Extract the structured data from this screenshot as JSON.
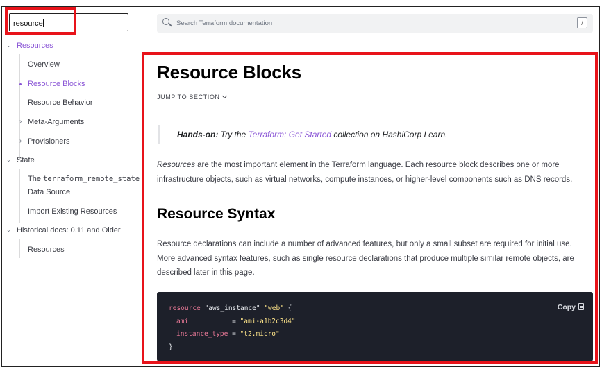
{
  "sidebar": {
    "filter_value": "resource",
    "items": [
      {
        "label": "Resources",
        "chevron": "⌄"
      },
      {
        "label": "Overview"
      },
      {
        "label": "Resource Blocks"
      },
      {
        "label": "Resource Behavior"
      },
      {
        "label": "Meta-Arguments",
        "chevron": "›"
      },
      {
        "label": "Provisioners",
        "chevron": "›"
      },
      {
        "label": "State",
        "chevron": "⌄"
      },
      {
        "label_line1_prefix": "The ",
        "label_line1_code": "terraform_remote_state",
        "label_line2": "Data Source"
      },
      {
        "label": "Import Existing Resources"
      },
      {
        "label": "Historical docs: 0.11 and Older",
        "chevron": "⌄"
      },
      {
        "label": "Resources"
      }
    ]
  },
  "search": {
    "placeholder": "Search Terraform documentation",
    "shortcut": "/"
  },
  "main": {
    "title": "Resource Blocks",
    "jump_label": "JUMP TO SECTION",
    "callout": {
      "bold": "Hands-on:",
      "before_link": " Try the ",
      "link": "Terraform: Get Started",
      "after_link": " collection on HashiCorp Learn."
    },
    "para1": {
      "italic": "Resources",
      "line1_rest": " are the most important element in the Terraform language. Each resource block describes one or more",
      "line2": "infrastructure objects, such as virtual networks, compute instances, or higher-level components such as DNS records."
    },
    "subtitle": "Resource Syntax",
    "para2": {
      "line1": "Resource declarations can include a number of advanced features, but only a small subset are required for initial use.",
      "line2": "More advanced syntax features, such as single resource declarations that produce multiple similar remote objects, are",
      "line3": "described later in this page."
    },
    "code": {
      "copy_label": "Copy",
      "l1_kw": "resource",
      "l1_s1": "\"aws_instance\"",
      "l1_s2": "\"web\"",
      "l1_brace": " {",
      "l2_key": "ami",
      "l2_eq": "           = ",
      "l2_val": "\"ami-a1b2c3d4\"",
      "l3_key": "instance_type",
      "l3_eq": " = ",
      "l3_val": "\"t2.micro\"",
      "l4": "}"
    }
  },
  "colors": {
    "accent": "#8a55d6",
    "highlight": "#e8131a",
    "code_bg": "#1d202a"
  }
}
